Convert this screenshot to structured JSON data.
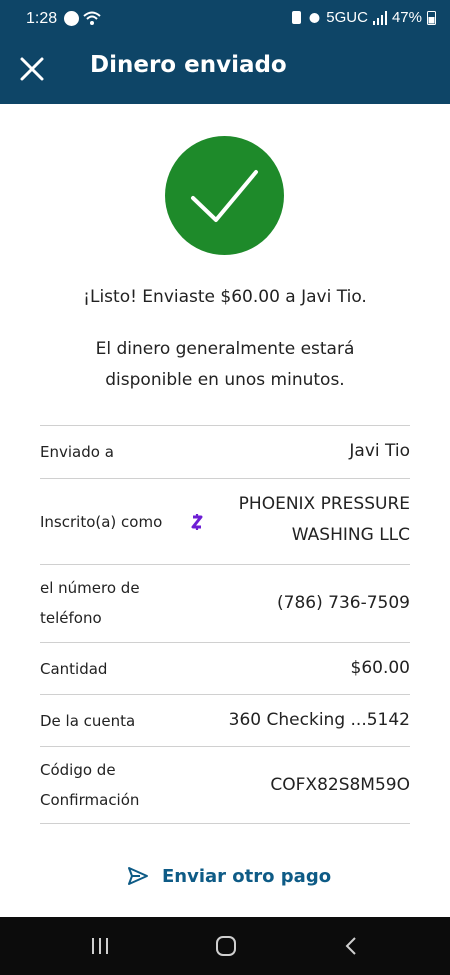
{
  "status_bar": {
    "time": "1:28",
    "network": "5GUC",
    "battery": "47%",
    "icons": [
      "notification-icon",
      "wifi-icon",
      "battery-saver-icon",
      "alarm-icon",
      "signal-icon",
      "battery-icon"
    ]
  },
  "header": {
    "title": "Dinero enviado",
    "close_icon": "close-icon",
    "background_color": "#0e4567"
  },
  "confirmation": {
    "icon": "checkmark-icon",
    "icon_color": "#1e8a2a",
    "success_message": "¡Listo! Enviaste $60.00 a Javi Tio.",
    "info_message": "El dinero generalmente estará disponible en unos minutos."
  },
  "details": {
    "sent_to": {
      "label": "Enviado a",
      "value": "Javi Tio"
    },
    "enrolled_as": {
      "label": "Inscrito(a) como",
      "icon": "zelle-icon",
      "value_line1": "PHOENIX PRESSURE",
      "value_line2": "WASHING LLC"
    },
    "phone": {
      "label_line1": "el número de",
      "label_line2": "teléfono",
      "value": "(786) 736-7509"
    },
    "amount": {
      "label": "Cantidad",
      "value": "$60.00"
    },
    "from_account": {
      "label": "De la cuenta",
      "value": "360 Checking ...5142"
    },
    "confirmation_code": {
      "label_line1": "Código de",
      "label_line2": "Confirmación",
      "value": "COFX82S8M59O"
    }
  },
  "actions": {
    "send_another_label": "Enviar otro pago",
    "send_icon": "send-icon",
    "accent_color": "#0e5b86"
  },
  "nav_bar": {
    "buttons": [
      "recents-icon",
      "home-icon",
      "back-icon"
    ]
  }
}
